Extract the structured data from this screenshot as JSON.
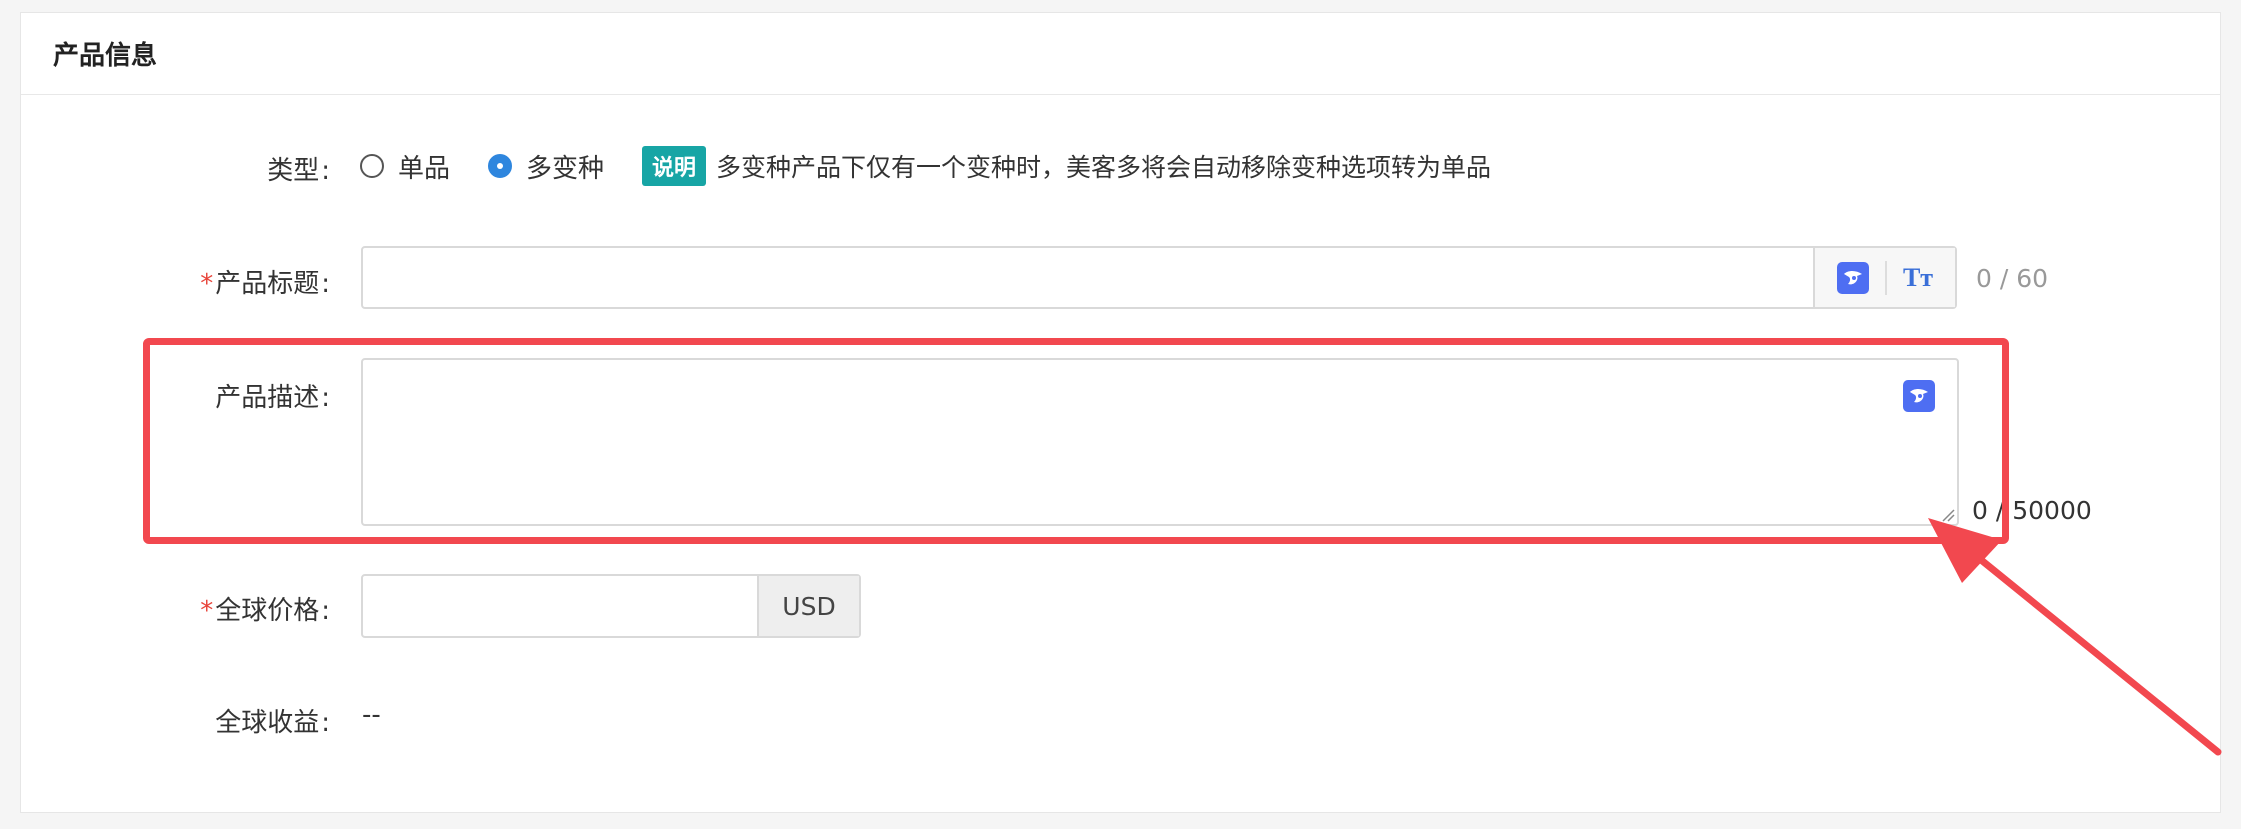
{
  "section": {
    "title": "产品信息"
  },
  "type_row": {
    "label": "类型",
    "options": [
      {
        "label": "单品",
        "checked": false
      },
      {
        "label": "多变种",
        "checked": true
      }
    ],
    "badge": "说明",
    "note": "多变种产品下仅有一个变种时，美客多将会自动移除变种选项转为单品"
  },
  "title_row": {
    "required": "*",
    "label": "产品标题",
    "value": "",
    "counter": "0 / 60",
    "font_icon": "Tт"
  },
  "description_row": {
    "label": "产品描述",
    "value": "",
    "counter": "0 / 50000"
  },
  "price_row": {
    "required": "*",
    "label": "全球价格",
    "value": "",
    "currency": "USD"
  },
  "earning_row": {
    "label": "全球收益",
    "value": "--"
  },
  "colon": ":",
  "icons": {
    "ai": "ai-assistant-icon",
    "font": "text-size-icon",
    "resize": "resize-handle-icon"
  },
  "colors": {
    "accent": "#2e86de",
    "badge": "#17a5a5",
    "ai_icon": "#4e6ef2",
    "annotation": "#f2484f",
    "required": "#e8443a"
  }
}
